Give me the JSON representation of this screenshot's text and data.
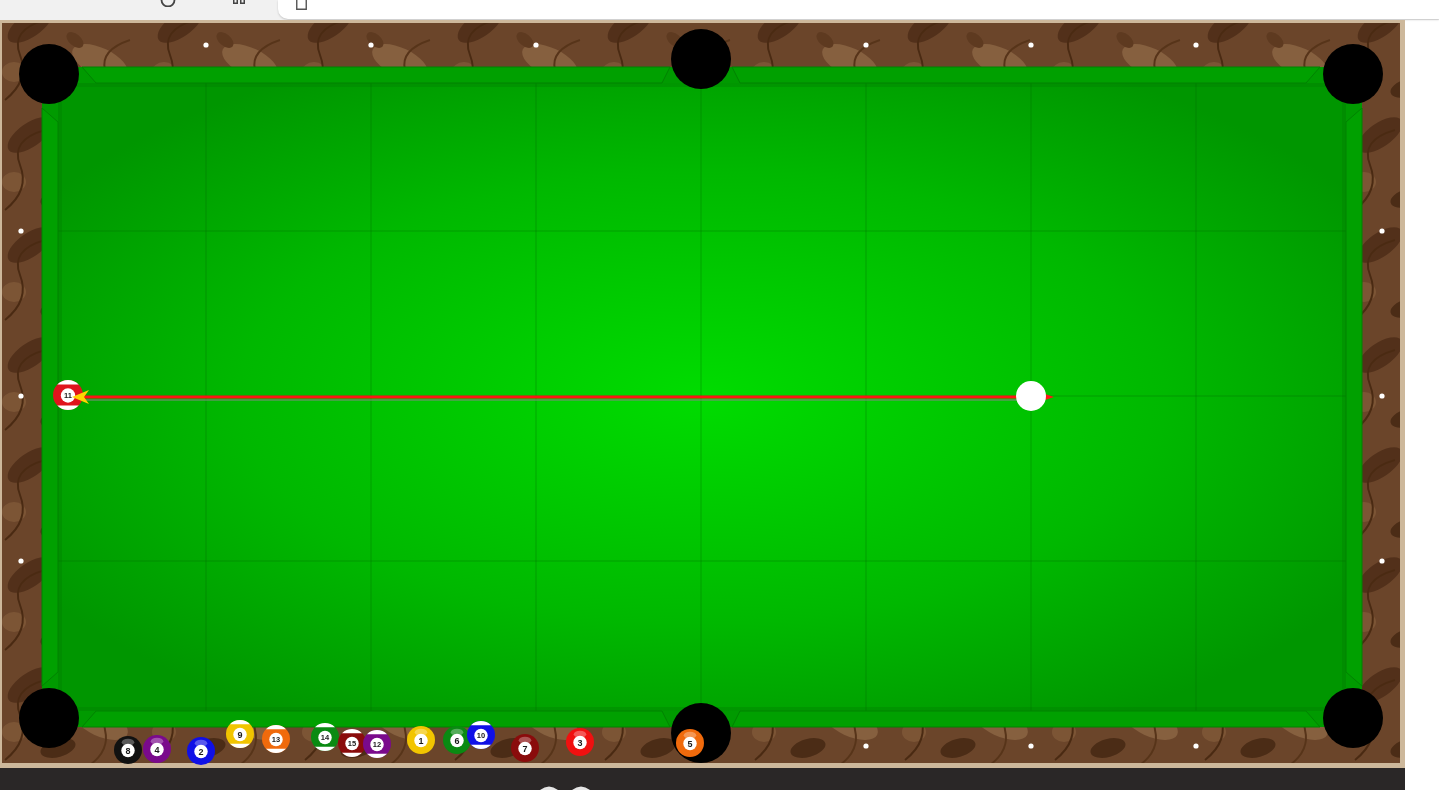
{
  "table": {
    "balls_on_table": [
      {
        "kind": "stripe",
        "number": "11",
        "color": "#e0141c"
      },
      {
        "kind": "cue"
      }
    ],
    "pocketed_balls": [
      {
        "kind": "solid",
        "number": "8",
        "color": "#111111"
      },
      {
        "kind": "solid",
        "number": "4",
        "color": "#7a0a8c"
      },
      {
        "kind": "solid",
        "number": "2",
        "color": "#1010e6"
      },
      {
        "kind": "stripe",
        "number": "9",
        "color": "#f2c500"
      },
      {
        "kind": "stripe",
        "number": "13",
        "color": "#f06a0c"
      },
      {
        "kind": "stripe",
        "number": "14",
        "color": "#0a8a12"
      },
      {
        "kind": "stripe",
        "number": "15",
        "color": "#8a0c0c"
      },
      {
        "kind": "stripe",
        "number": "12",
        "color": "#7a0a8c"
      },
      {
        "kind": "solid",
        "number": "1",
        "color": "#f2c500"
      },
      {
        "kind": "solid",
        "number": "6",
        "color": "#0a8a12"
      },
      {
        "kind": "stripe",
        "number": "10",
        "color": "#1010e6"
      },
      {
        "kind": "solid",
        "number": "7",
        "color": "#8a0c0c"
      },
      {
        "kind": "solid",
        "number": "3",
        "color": "#f01010"
      },
      {
        "kind": "solid",
        "number": "5",
        "color": "#f06a0c"
      }
    ]
  }
}
